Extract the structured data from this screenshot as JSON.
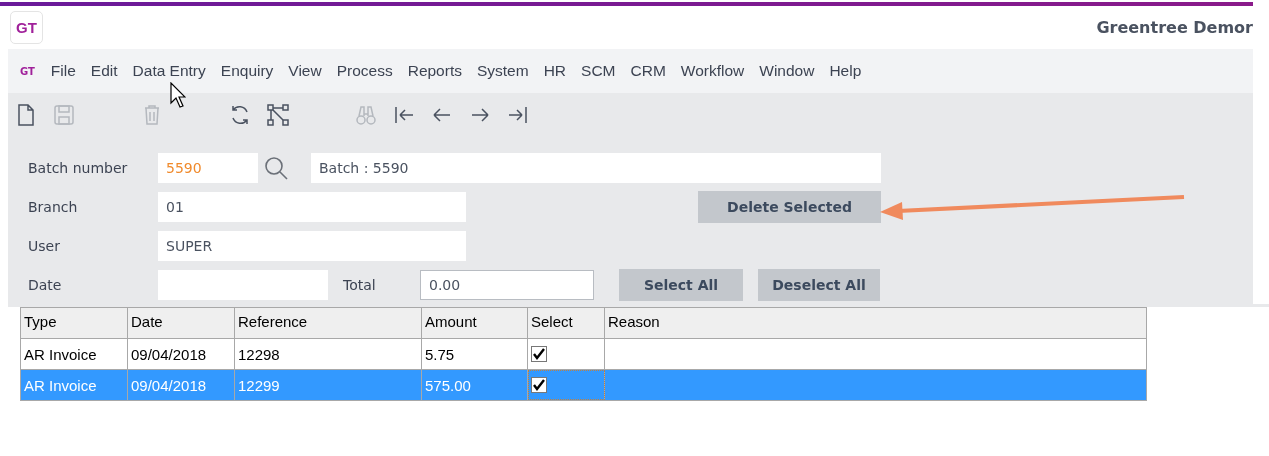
{
  "window": {
    "logo": "GT",
    "title": "Greentree Demor"
  },
  "menu": {
    "logo": "GT",
    "items": [
      "File",
      "Edit",
      "Data Entry",
      "Enquiry",
      "View",
      "Process",
      "Reports",
      "System",
      "HR",
      "SCM",
      "CRM",
      "Workflow",
      "Window",
      "Help"
    ]
  },
  "toolbar": [
    {
      "disabled": false
    },
    {
      "disabled": true
    },
    {
      "disabled": true
    },
    {
      "disabled": false
    },
    {
      "disabled": false
    },
    {
      "disabled": true
    },
    {
      "disabled": false
    },
    {
      "disabled": false
    },
    {
      "disabled": false
    },
    {
      "disabled": false
    }
  ],
  "form": {
    "batch_label": "Batch number",
    "batch_value": "5590",
    "batch_description": "Batch : 5590",
    "branch_label": "Branch",
    "branch_value": "01",
    "user_label": "User",
    "user_value": "SUPER",
    "date_label": "Date",
    "total_label": "Total",
    "total_value": "0.00"
  },
  "buttons": {
    "delete": "Delete Selected",
    "select_all": "Select All",
    "deselect_all": "Deselect All"
  },
  "table": {
    "columns": [
      "Type",
      "Date",
      "Reference",
      "Amount",
      "Select",
      "Reason"
    ],
    "rows": [
      {
        "type": "AR Invoice",
        "date": "09/04/2018",
        "reference": "12298",
        "amount": "5.75",
        "checked": true,
        "selected": false
      },
      {
        "type": "AR Invoice",
        "date": "09/04/2018",
        "reference": "12299",
        "amount": "575.00",
        "checked": true,
        "selected": true
      }
    ]
  }
}
